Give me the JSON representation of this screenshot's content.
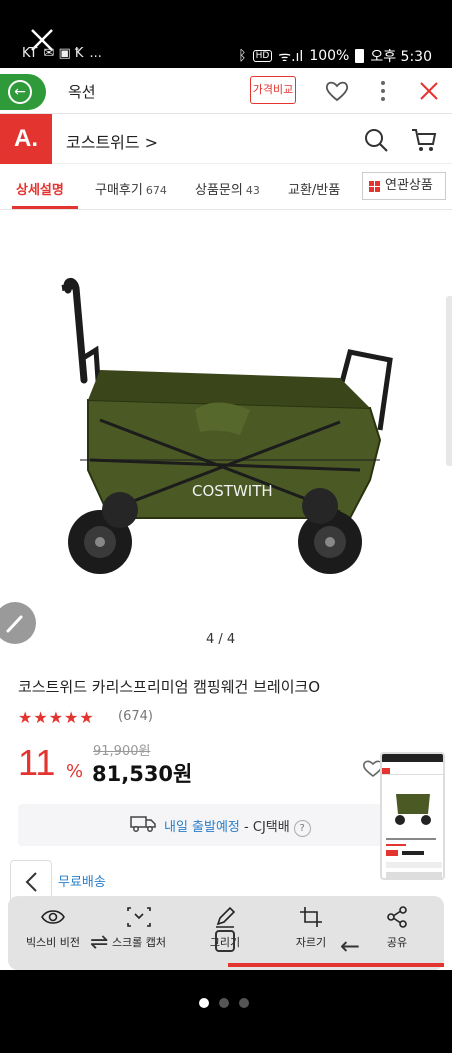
{
  "statusbar": {
    "carrier": "KT",
    "notif_more": "...",
    "battery": "100%",
    "time": "오후 5:30",
    "signal_hd": "HD"
  },
  "browser": {
    "tab_title": "옥션",
    "price_compare": "가격비교"
  },
  "app": {
    "logo": "A.",
    "store_name": "코스트위드 >"
  },
  "tabs": [
    {
      "label": "상세설명",
      "count": ""
    },
    {
      "label": "구매후기",
      "count": "674"
    },
    {
      "label": "상품문의",
      "count": "43"
    },
    {
      "label": "교환/반품",
      "count": ""
    },
    {
      "label": "연관상품",
      "count": ""
    }
  ],
  "product": {
    "image_counter": "4 / 4",
    "brand_on_image": "COSTWITH",
    "title": "코스트위드 카리스프리미엄 캠핑웨건 브레이크O",
    "stars": "★★★★★",
    "rating": 5,
    "review_count": "(674)",
    "discount": "11",
    "discount_unit": "%",
    "original_price": "91,900원",
    "sale_price": "81,530원",
    "shipping_date": "내일 출발예정",
    "shipping_carrier": " - CJ택배",
    "shipping_help": "?",
    "free_shipping": "무료배송"
  },
  "capture_toolbar": {
    "items": [
      {
        "label": "빅스비 비전",
        "icon": "eye-icon"
      },
      {
        "label": "스크롤 캡처",
        "icon": "scroll-capture-icon"
      },
      {
        "label": "그리기",
        "icon": "pencil-icon"
      },
      {
        "label": "자르기",
        "icon": "crop-icon"
      },
      {
        "label": "공유",
        "icon": "share-icon"
      }
    ]
  },
  "colors": {
    "accent": "#e3342f",
    "browser_green": "#2e9a3a",
    "link_blue": "#2a7fc9",
    "wagon_green": "#4b5a25"
  }
}
